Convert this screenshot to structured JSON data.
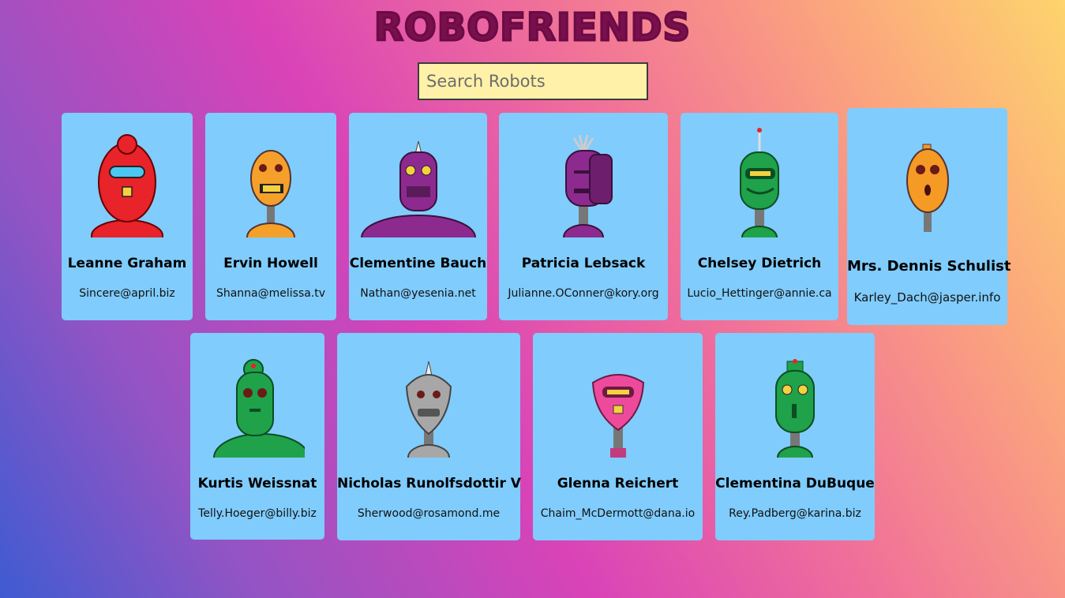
{
  "header": {
    "title": "ROBOFRIENDS"
  },
  "search": {
    "placeholder": "Search Robots"
  },
  "robots": [
    {
      "name": "Leanne Graham",
      "email": "Sincere@april.biz",
      "color": "#e8232a"
    },
    {
      "name": "Ervin Howell",
      "email": "Shanna@melissa.tv",
      "color": "#f5a02a"
    },
    {
      "name": "Clementine Bauch",
      "email": "Nathan@yesenia.net",
      "color": "#8d2a8f"
    },
    {
      "name": "Patricia Lebsack",
      "email": "Julianne.OConner@kory.org",
      "color": "#8d2a8f"
    },
    {
      "name": "Chelsey Dietrich",
      "email": "Lucio_Hettinger@annie.ca",
      "color": "#1fa24a"
    },
    {
      "name": "Mrs. Dennis Schulist",
      "email": "Karley_Dach@jasper.info",
      "color": "#f59a24"
    },
    {
      "name": "Kurtis Weissnat",
      "email": "Telly.Hoeger@billy.biz",
      "color": "#1fa24a"
    },
    {
      "name": "Nicholas Runolfsdottir V",
      "email": "Sherwood@rosamond.me",
      "color": "#a7a7a7"
    },
    {
      "name": "Glenna Reichert",
      "email": "Chaim_McDermott@dana.io",
      "color": "#ee4a9c"
    },
    {
      "name": "Clementina DuBuque",
      "email": "Rey.Padberg@karina.biz",
      "color": "#1fa24a"
    }
  ]
}
